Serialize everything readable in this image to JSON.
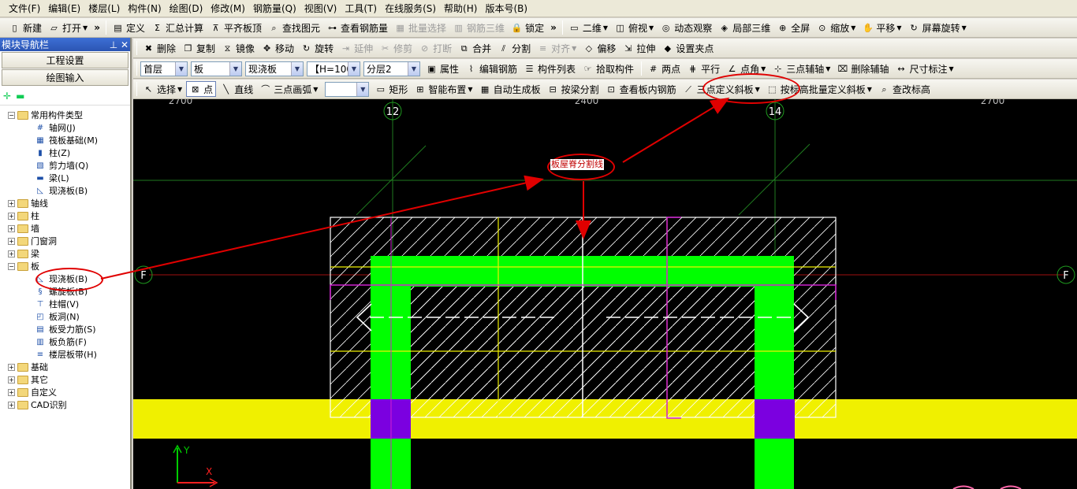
{
  "menubar": [
    "文件(F)",
    "编辑(E)",
    "楼层(L)",
    "构件(N)",
    "绘图(D)",
    "修改(M)",
    "钢筋量(Q)",
    "视图(V)",
    "工具(T)",
    "在线服务(S)",
    "帮助(H)",
    "版本号(B)"
  ],
  "toolbar1_left": [
    {
      "label": "新建",
      "icon": "new-file-icon"
    },
    {
      "label": "打开",
      "icon": "open-folder-icon",
      "dropdown": true
    }
  ],
  "toolbar1_mid": [
    {
      "label": "定义",
      "icon": "define-icon"
    },
    {
      "label": "汇总计算",
      "icon": "sigma-icon"
    },
    {
      "label": "平齐板顶",
      "icon": "align-slab-icon"
    },
    {
      "label": "查找图元",
      "icon": "find-element-icon"
    },
    {
      "label": "查看钢筋量",
      "icon": "view-rebar-icon"
    },
    {
      "label": "批量选择",
      "icon": "batch-select-icon",
      "disabled": true
    },
    {
      "label": "钢筋三维",
      "icon": "rebar-3d-icon",
      "disabled": true
    },
    {
      "label": "锁定",
      "icon": "lock-icon"
    }
  ],
  "toolbar1_right": [
    {
      "label": "二维",
      "icon": "2d-view-icon",
      "combo": true
    },
    {
      "label": "俯视",
      "icon": "top-view-icon",
      "dropdown": true
    },
    {
      "label": "动态观察",
      "icon": "orbit-icon"
    },
    {
      "label": "局部三维",
      "icon": "local-3d-icon"
    },
    {
      "label": "全屏",
      "icon": "fullscreen-icon"
    },
    {
      "label": "缩放",
      "icon": "zoom-icon",
      "dropdown": true
    },
    {
      "label": "平移",
      "icon": "pan-icon",
      "dropdown": true
    },
    {
      "label": "屏幕旋转",
      "icon": "rotate-screen-icon",
      "dropdown": true
    }
  ],
  "toolbar2": [
    {
      "label": "删除",
      "icon": "delete-icon"
    },
    {
      "label": "复制",
      "icon": "copy-icon"
    },
    {
      "label": "镜像",
      "icon": "mirror-icon"
    },
    {
      "label": "移动",
      "icon": "move-icon"
    },
    {
      "label": "旋转",
      "icon": "rotate-icon"
    },
    {
      "label": "延伸",
      "icon": "extend-icon",
      "disabled": true
    },
    {
      "label": "修剪",
      "icon": "trim-icon",
      "disabled": true
    },
    {
      "label": "打断",
      "icon": "break-icon",
      "disabled": true
    },
    {
      "label": "合并",
      "icon": "merge-icon"
    },
    {
      "label": "分割",
      "icon": "split-icon"
    },
    {
      "label": "对齐",
      "icon": "align-icon",
      "disabled": true,
      "dropdown": true
    },
    {
      "label": "偏移",
      "icon": "offset-icon"
    },
    {
      "label": "拉伸",
      "icon": "stretch-icon"
    },
    {
      "label": "设置夹点",
      "icon": "grip-icon"
    }
  ],
  "toolbar3_combos": [
    "首层",
    "板",
    "现浇板",
    "【H=100】",
    "分层2"
  ],
  "toolbar3_buttons": [
    {
      "label": "属性",
      "icon": "properties-icon"
    },
    {
      "label": "编辑钢筋",
      "icon": "edit-rebar-icon"
    },
    {
      "label": "构件列表",
      "icon": "component-list-icon"
    },
    {
      "label": "拾取构件",
      "icon": "pick-component-icon"
    }
  ],
  "toolbar3_right": [
    {
      "label": "两点",
      "icon": "two-point-axis-icon"
    },
    {
      "label": "平行",
      "icon": "parallel-axis-icon"
    },
    {
      "label": "点角",
      "icon": "point-angle-icon",
      "dropdown": true
    },
    {
      "label": "三点辅轴",
      "icon": "three-point-axis-icon",
      "dropdown": true
    },
    {
      "label": "删除辅轴",
      "icon": "delete-axis-icon"
    },
    {
      "label": "尺寸标注",
      "icon": "dimension-icon",
      "dropdown": true
    }
  ],
  "toolbar4": [
    {
      "label": "选择",
      "icon": "cursor-icon",
      "dropdown": true
    },
    {
      "label": "点",
      "icon": "point-icon",
      "pressed": true
    },
    {
      "label": "直线",
      "icon": "line-icon"
    },
    {
      "label": "三点画弧",
      "icon": "arc-icon",
      "dropdown": true
    }
  ],
  "toolbar4_right": [
    {
      "label": "矩形",
      "icon": "rectangle-icon"
    },
    {
      "label": "智能布置",
      "icon": "smart-layout-icon",
      "dropdown": true
    },
    {
      "label": "自动生成板",
      "icon": "auto-slab-icon"
    },
    {
      "label": "按梁分割",
      "icon": "split-by-beam-icon"
    },
    {
      "label": "查看板内钢筋",
      "icon": "view-slab-rebar-icon"
    },
    {
      "label": "三点定义斜板",
      "icon": "three-point-slope-icon",
      "dropdown": true
    },
    {
      "label": "按标高批量定义斜板",
      "icon": "batch-slope-icon",
      "dropdown": true
    },
    {
      "label": "查改标高",
      "icon": "check-elevation-icon"
    }
  ],
  "panel": {
    "title": "模块导航栏",
    "btn_settings": "工程设置",
    "btn_draw": "绘图输入",
    "common_group": "常用构件类型",
    "common_items": [
      {
        "label": "轴网(J)",
        "icon": "grid-icon"
      },
      {
        "label": "筏板基础(M)",
        "icon": "raft-foundation-icon"
      },
      {
        "label": "柱(Z)",
        "icon": "column-icon"
      },
      {
        "label": "剪力墙(Q)",
        "icon": "shear-wall-icon"
      },
      {
        "label": "梁(L)",
        "icon": "beam-icon"
      },
      {
        "label": "现浇板(B)",
        "icon": "cast-slab-icon"
      }
    ],
    "groups_top": [
      "轴线",
      "柱",
      "墙",
      "门窗洞",
      "梁"
    ],
    "slab_group": "板",
    "slab_items": [
      {
        "label": "现浇板(B)",
        "icon": "cast-slab-icon"
      },
      {
        "label": "螺旋板(B)",
        "icon": "spiral-slab-icon"
      },
      {
        "label": "柱帽(V)",
        "icon": "column-cap-icon"
      },
      {
        "label": "板洞(N)",
        "icon": "slab-hole-icon"
      },
      {
        "label": "板受力筋(S)",
        "icon": "slab-main-rebar-icon"
      },
      {
        "label": "板负筋(F)",
        "icon": "slab-negative-rebar-icon"
      },
      {
        "label": "楼层板带(H)",
        "icon": "floor-strip-icon"
      }
    ],
    "groups_bottom": [
      "基础",
      "其它",
      "自定义",
      "CAD识别"
    ]
  },
  "canvas": {
    "axis_labels": {
      "top_left": "12",
      "top_right": "14",
      "left": "F",
      "right": "F"
    },
    "dims": [
      "2700",
      "2400",
      "2700"
    ],
    "callout": "板屋脊分割线",
    "ucs_y": "Y",
    "ucs_x": "X"
  },
  "colors": {
    "annotation": "#e00000",
    "beam": "#00ff00",
    "wall": "#f0f000",
    "column": "#7b00e0",
    "slab_line": "#ffffff",
    "grid": "#1f7a1f"
  }
}
